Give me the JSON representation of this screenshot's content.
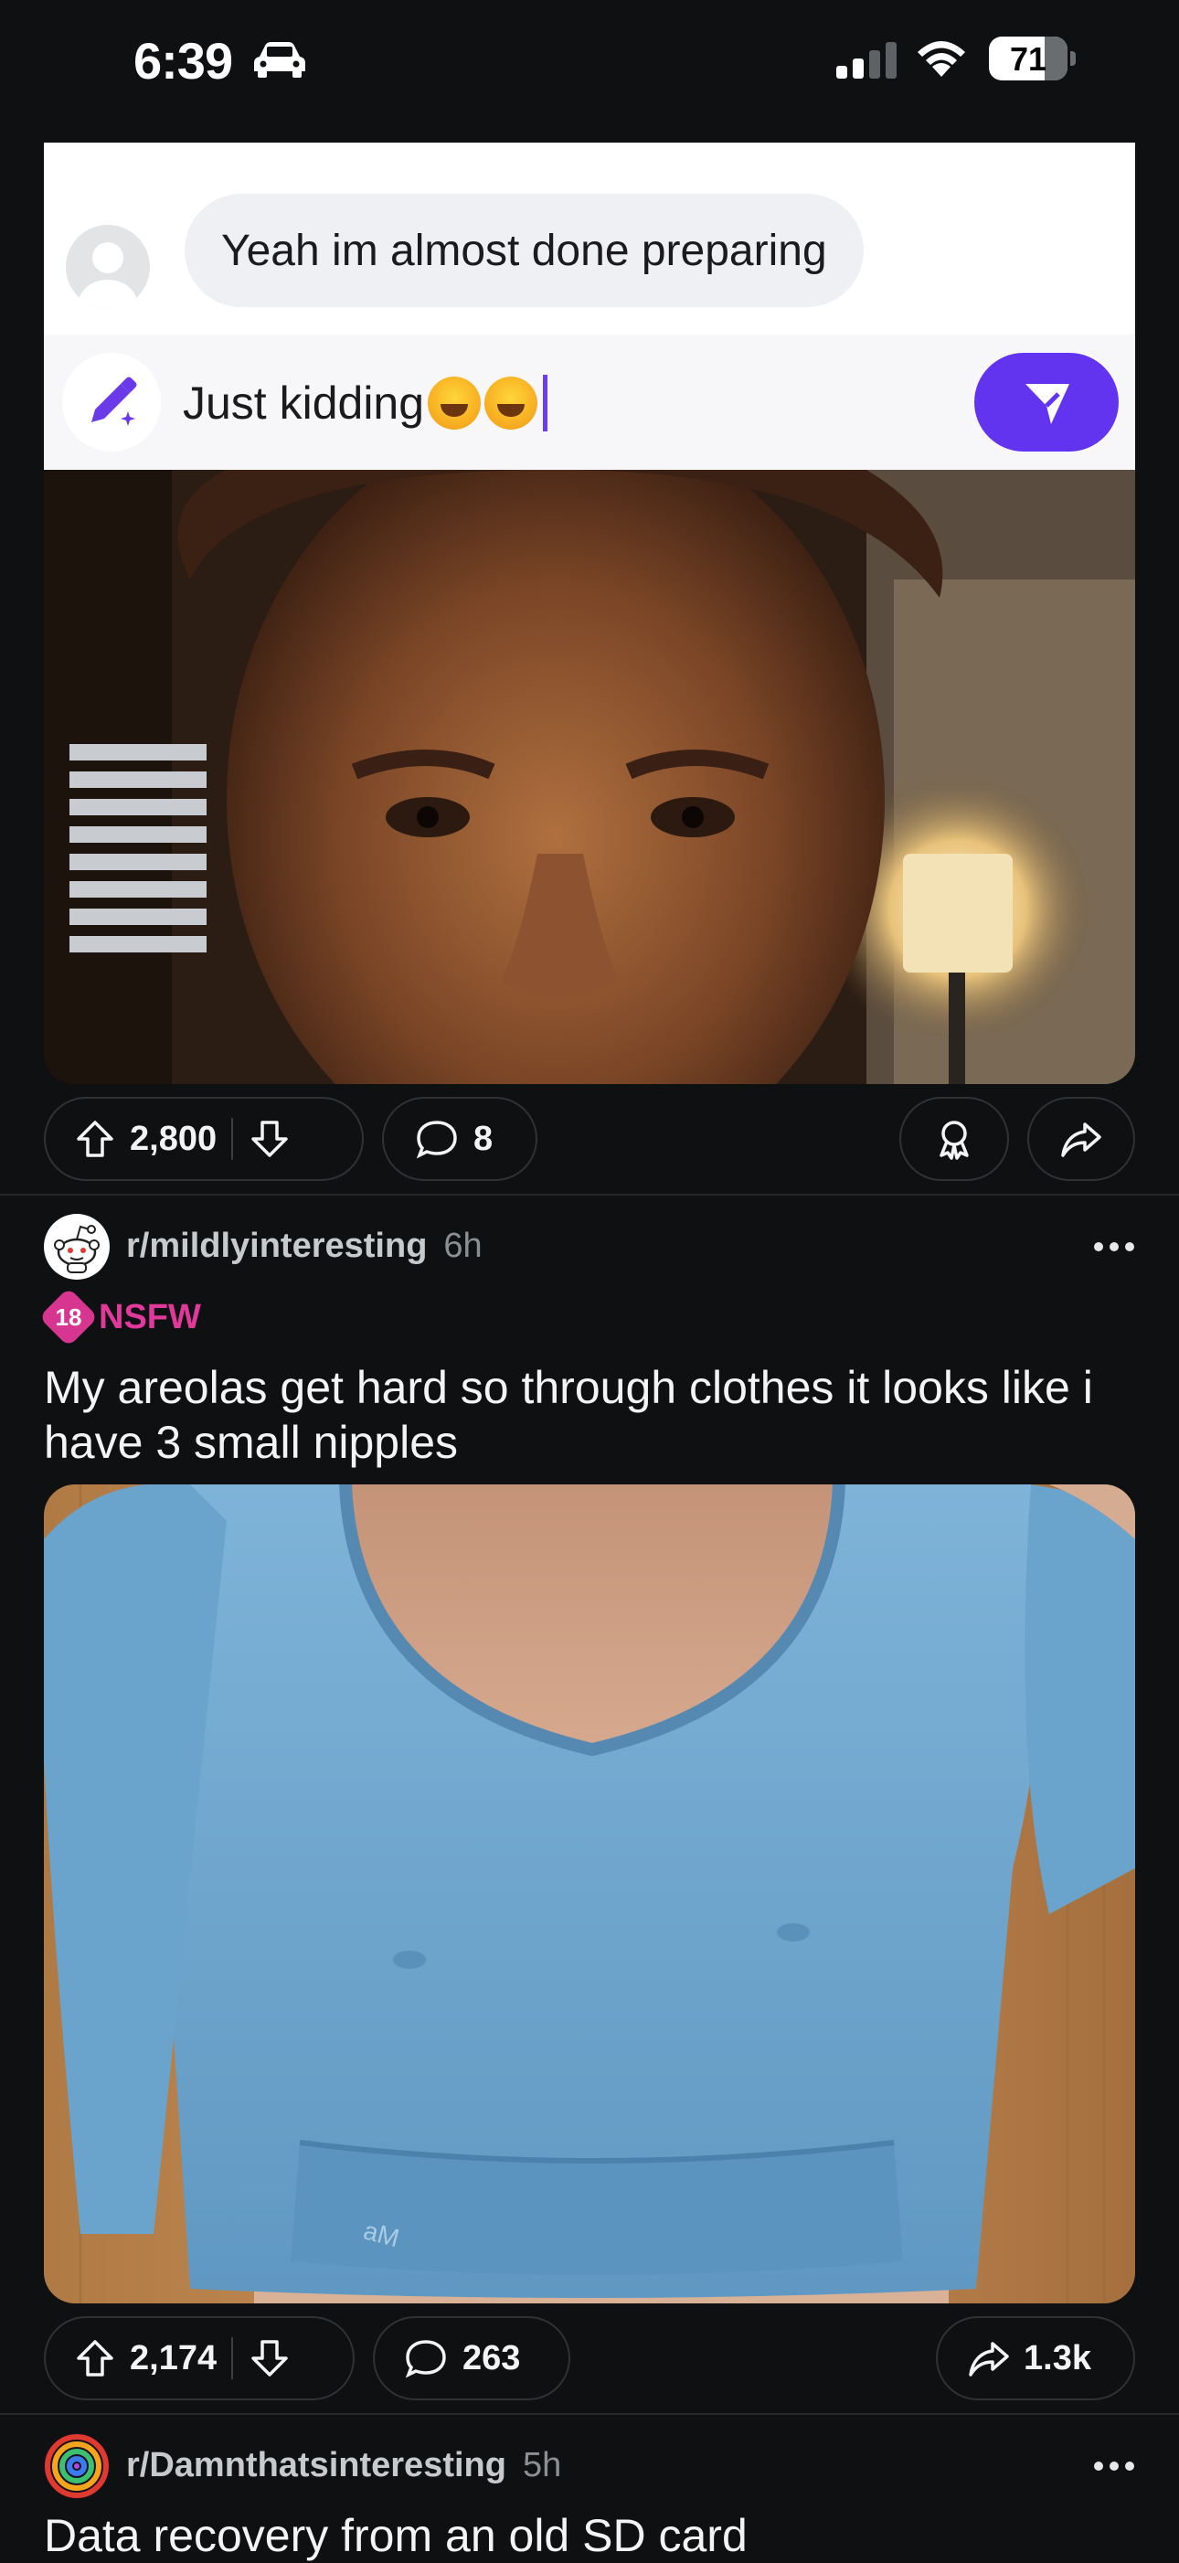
{
  "status_bar": {
    "time": "6:39",
    "battery": "71",
    "battery_level": 0.71
  },
  "post1": {
    "chat": {
      "message": "Yeah im almost done preparing",
      "compose_text": "Just kidding"
    },
    "votes": "2,800",
    "comments": "8"
  },
  "post2": {
    "subreddit": "r/mildlyinteresting",
    "age": "6h",
    "nsfw_badge": "18",
    "nsfw_label": "NSFW",
    "title": "My areolas get hard so through clothes it looks like i have 3 small nipples",
    "shirt_logo": "aM",
    "votes": "2,174",
    "comments": "263",
    "shares": "1.3k"
  },
  "post3": {
    "subreddit": "r/Damnthatsinteresting",
    "age": "5h",
    "title": "Data recovery from an old SD card"
  },
  "colors": {
    "background": "#0e1012",
    "accent_purple": "#6334f0",
    "nsfw_pink": "#e0399b",
    "text_primary": "#f2f4f5",
    "text_secondary": "#8a8f94"
  }
}
